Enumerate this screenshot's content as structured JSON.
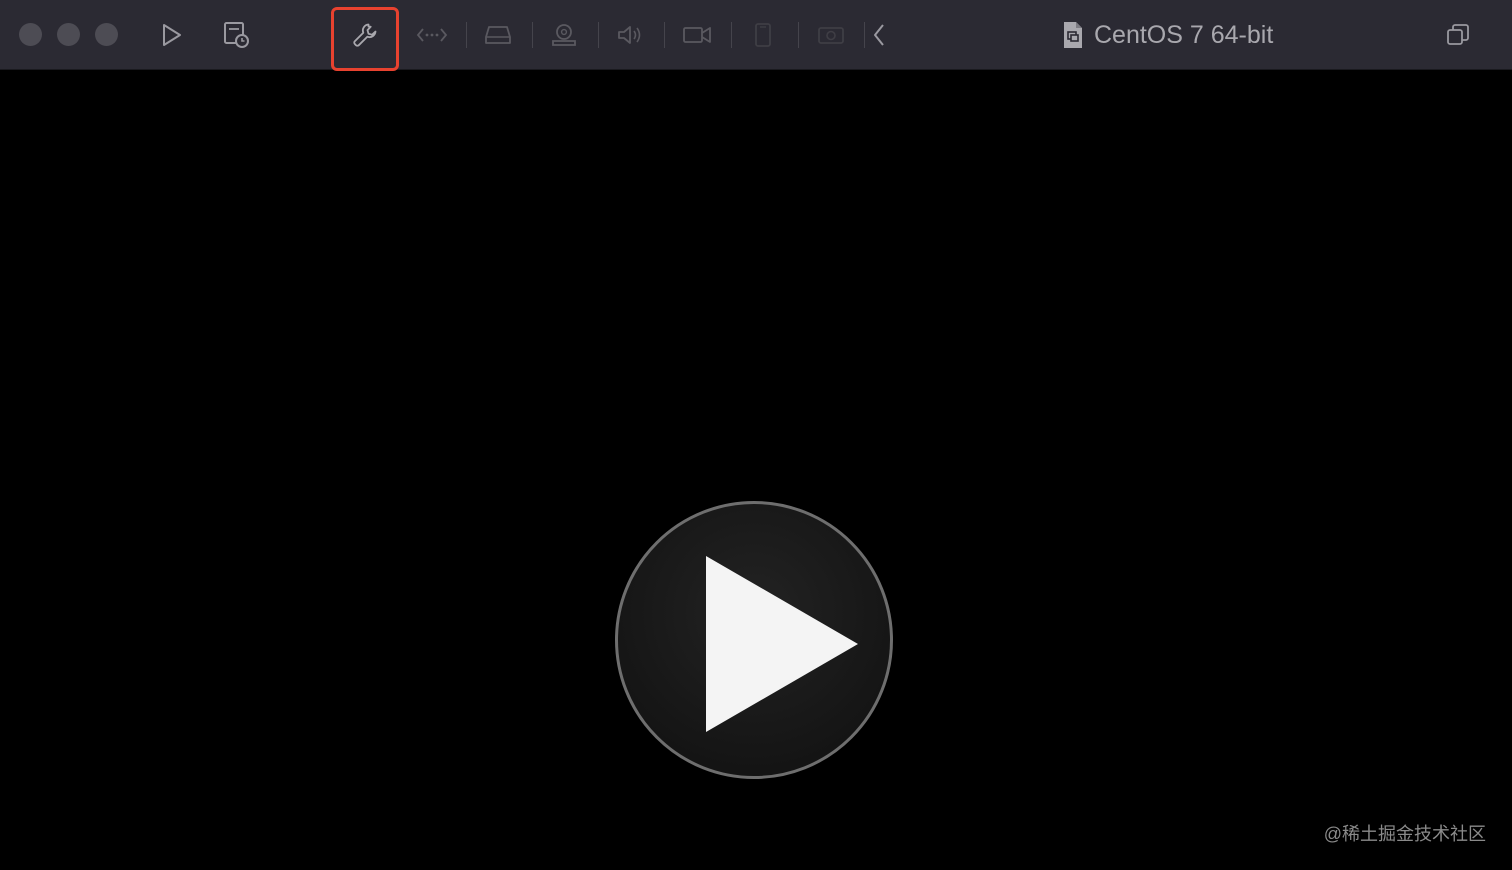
{
  "window": {
    "title": "CentOS 7 64-bit"
  },
  "toolbar": {
    "items": [
      {
        "name": "start-button",
        "icon": "play-outline-icon",
        "state": "enabled"
      },
      {
        "name": "snapshots-button",
        "icon": "snapshot-icon",
        "state": "enabled"
      },
      {
        "name": "settings-button",
        "icon": "wrench-icon",
        "state": "highlighted"
      },
      {
        "name": "network-button",
        "icon": "network-icon",
        "state": "dimmed"
      },
      {
        "name": "hard-disk-button",
        "icon": "hard-disk-icon",
        "state": "dimmed"
      },
      {
        "name": "usb-button",
        "icon": "camera-dome-icon",
        "state": "dimmed"
      },
      {
        "name": "sound-button",
        "icon": "speaker-icon",
        "state": "dimmed"
      },
      {
        "name": "camera-button",
        "icon": "video-camera-icon",
        "state": "dimmed"
      },
      {
        "name": "device-button",
        "icon": "device-icon",
        "state": "dimmed"
      },
      {
        "name": "screenshot-button",
        "icon": "photo-icon",
        "state": "dimmed"
      },
      {
        "name": "collapse-button",
        "icon": "chevron-left-icon",
        "state": "enabled"
      }
    ]
  },
  "overlay": {
    "watermark": "@稀土掘金技术社区"
  },
  "colors": {
    "titlebar": "#2b2a33",
    "icon": "#9a99a0",
    "icon_dimmed": "#5a5960",
    "highlight": "#e8422f",
    "background": "#000000",
    "play": "#f4f4f4"
  }
}
